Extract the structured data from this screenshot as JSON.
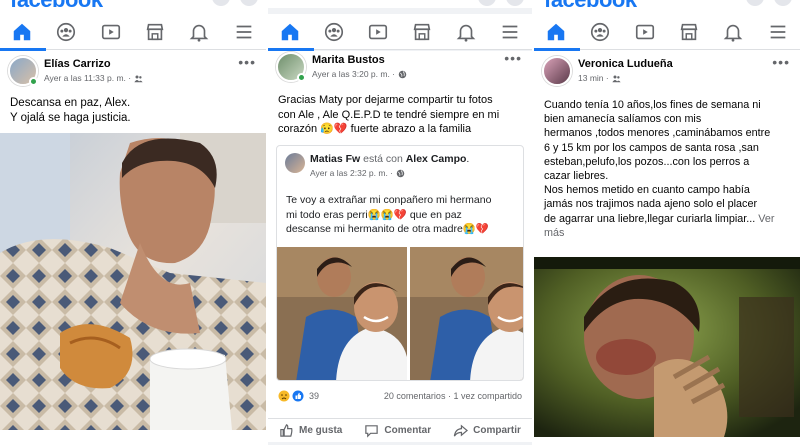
{
  "brand": "facebook",
  "colors": {
    "accent": "#1877f2",
    "online": "#31a24c",
    "muted": "#65676b"
  },
  "nav_icons": [
    "home-icon",
    "groups-icon",
    "watch-icon",
    "marketplace-icon",
    "bell-icon",
    "menu-icon"
  ],
  "post1": {
    "author": "Elías Carrizo",
    "time": "Ayer a las 11:33 p. m. ·",
    "audience_icon": "friends-icon",
    "text_line1": "Descansa en paz, Alex.",
    "text_line2": "Y ojalá se haga justicia."
  },
  "post2": {
    "author": "Marita Bustos",
    "time": "Ayer a las 3:20 p. m. ·",
    "audience_icon": "globe-icon",
    "text_line1": "Gracias Maty por dejarme compartir tu fotos",
    "text_line2": "con Ale , Ale Q.E.P.D te tendré siempre en mi",
    "text_line3": "corazón 😥💔 fuerte abrazo a la familia",
    "shared": {
      "author": "Matias Fw",
      "with_text": " está con ",
      "with_name": "Alex Campo",
      "period": ".",
      "time": "Ayer a las 2:32 p. m. ·",
      "audience_icon": "globe-icon",
      "text_line1": "Te voy a extrañar mi conpañero mi hermano",
      "text_line2": "mi todo eras perri😭😭💔  que en paz",
      "text_line3": "descanse mi hermanito de otra madre😭💔"
    },
    "reaction_count": "39",
    "comments": "20 comentarios",
    "shares": "1 vez compartido",
    "like_label": "Me gusta",
    "comment_label": "Comentar",
    "share_label": "Compartir"
  },
  "post3": {
    "author": "Veronica Ludueña",
    "time": "13 min ·",
    "audience_icon": "friends-icon",
    "lines": [
      "Cuando tenía 10 años,los fines de semana ni",
      "bien amanecía salíamos con mis",
      "hermanos ,todos menores ,caminábamos entre",
      "6 y 15 km por los campos de santa rosa ,san",
      "esteban,pelufo,los pozos...con los perros a",
      "cazar liebres.",
      "Nos hemos metido en cuanto campo había",
      "jamás nos trajimos nada ajeno solo el placer",
      "de agarrar una liebre,llegar curiarla limpiar..."
    ],
    "see_more_1": "Ver",
    "see_more_2": "más"
  }
}
